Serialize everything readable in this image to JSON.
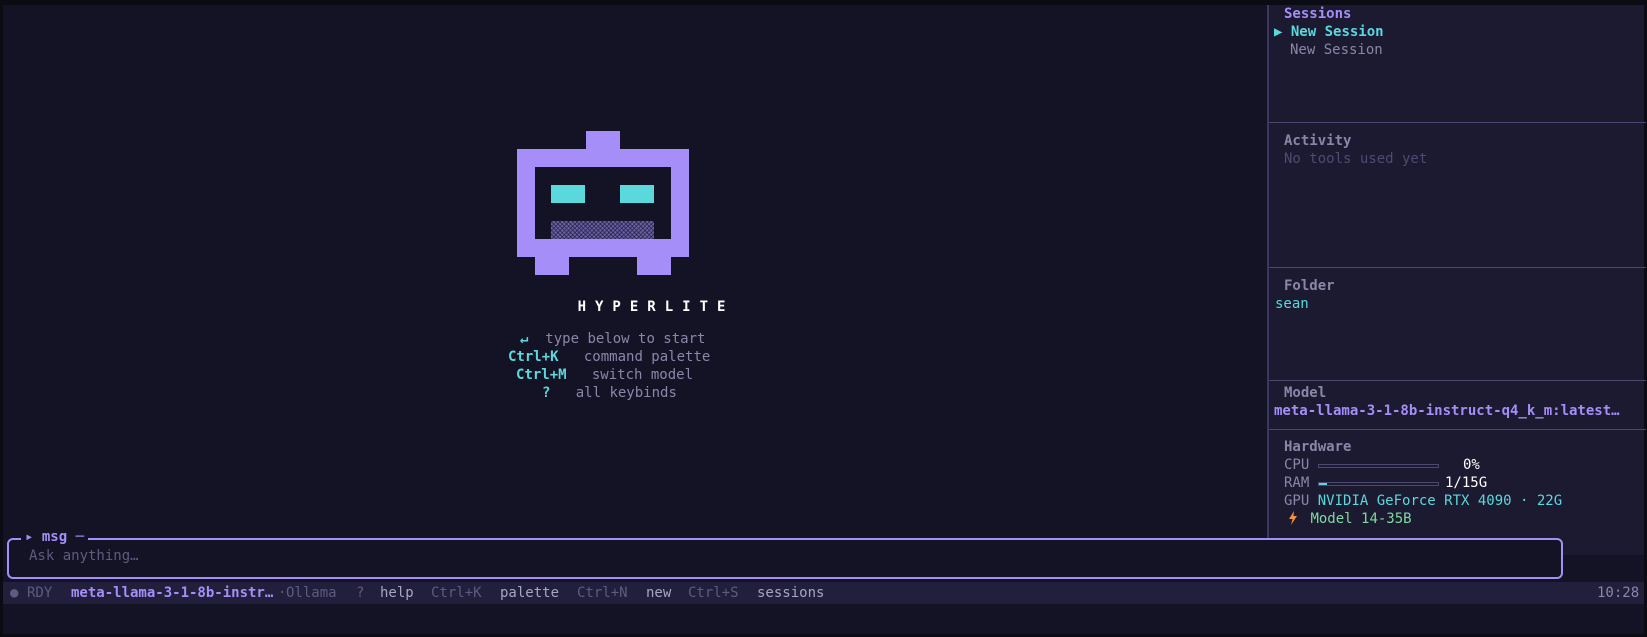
{
  "sidebar": {
    "sessions": {
      "title": "Sessions",
      "items": [
        {
          "marker": "▶",
          "label": "New Session"
        },
        {
          "marker": "",
          "label": "New Session"
        }
      ]
    },
    "activity": {
      "title": "Activity",
      "empty": "No tools used yet"
    },
    "folder": {
      "title": "Folder",
      "value": "sean"
    },
    "model": {
      "title": "Model",
      "value": "meta-llama-3-1-8b-instruct-q4_k_m:latest…"
    },
    "hardware": {
      "title": "Hardware",
      "cpu_label": "CPU",
      "cpu_value": "0%",
      "cpu_usage": 0,
      "ram_label": "RAM",
      "ram_value": "1/15G",
      "ram_usage": 0.067,
      "gpu_label": "GPU",
      "gpu_value": "NVIDIA GeForce RTX 4090 · 22G",
      "model_size": "Model 14-35B"
    }
  },
  "welcome": {
    "brand": "HYPERLITE",
    "hints": [
      {
        "key": "↵",
        "text": "type below to start"
      },
      {
        "key": "Ctrl+K",
        "text": "command palette"
      },
      {
        "key": "Ctrl+M",
        "text": "switch model"
      },
      {
        "key": "?",
        "text": "all keybinds"
      }
    ]
  },
  "input": {
    "label": "msg",
    "placeholder": "Ask anything…",
    "value": ""
  },
  "statusbar": {
    "status": "RDY",
    "model": "meta-llama-3-1-8b-instr…",
    "provider": "Ollama",
    "shortcuts": [
      {
        "key": "?",
        "label": "help"
      },
      {
        "key": "Ctrl+K",
        "label": "palette"
      },
      {
        "key": "Ctrl+N",
        "label": "new"
      },
      {
        "key": "Ctrl+S",
        "label": "sessions"
      }
    ],
    "time": "10:28"
  },
  "colors": {
    "accent": "#a58ef8",
    "cyan": "#5ad8dc",
    "green": "#7ed9a0",
    "orange": "#f0913c"
  }
}
